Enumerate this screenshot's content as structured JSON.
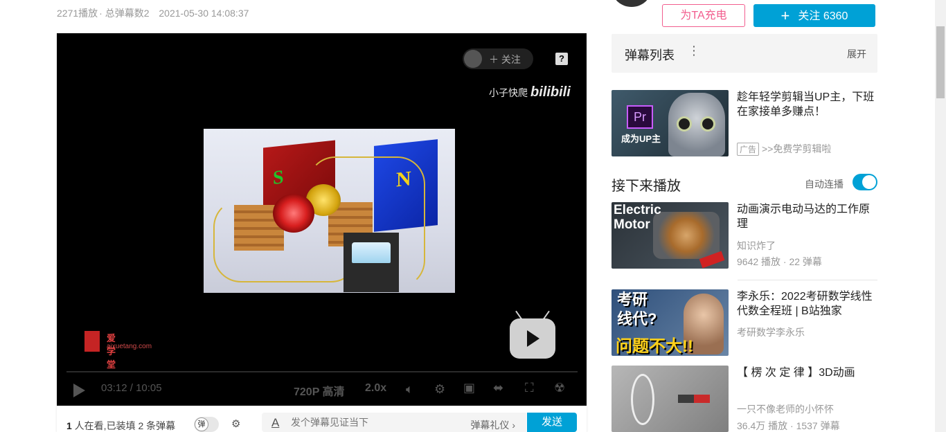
{
  "meta": {
    "plays": "2271播放",
    "danmaku": "· 总弹幕数2",
    "date": "2021-05-30 14:08:37"
  },
  "player": {
    "follow_label": "关注",
    "help": "?",
    "watermark_user": "小子快爬",
    "watermark_brand": "bilibili",
    "logo_text": "爱学堂",
    "logo_url": "aixuetang.com",
    "scene_s": "S",
    "scene_n": "N",
    "time_current": "03:12",
    "time_sep": "/",
    "time_total": "10:05",
    "quality": "720P 高清",
    "speed": "2.0x"
  },
  "danmaku_bar": {
    "watching_count": "1",
    "watching_text": " 人在看,已装填 2 条弹幕",
    "toggle_label": "弹",
    "input_placeholder": "发个弹幕见证当下",
    "etiquette": "弹幕礼仪 ›",
    "send": "发送"
  },
  "uploader": {
    "charge": "为TA充电",
    "follow": "关注 6360"
  },
  "danmaku_list": {
    "title": "弹幕列表",
    "expand": "展开"
  },
  "ad": {
    "title": "趁年轻学剪辑当UP主，下班在家接单多赚点！",
    "tag": "广告",
    "link": ">>免费学剪辑啦",
    "thumb_caption": "成为UP主",
    "thumb_app": "Pr"
  },
  "next": {
    "title": "接下来播放",
    "autoplay": "自动连播"
  },
  "recommendations": [
    {
      "title": "动画演示电动马达的工作原理",
      "author": "知识炸了",
      "stats": "9642 播放 · 22 弹幕",
      "thumb_text": "Electric Motor"
    },
    {
      "title": "李永乐：2022考研数学线性代数全程班 | B站独家",
      "author": "考研数学李永乐",
      "stats": "",
      "thumb_line1": "考研",
      "thumb_line2": "线代?",
      "thumb_big": "问题不大!!"
    },
    {
      "title": "【 楞 次 定 律 】3D动画",
      "author": "一只不像老师的小怀怀",
      "stats": "36.4万 播放 · 1537 弹幕"
    }
  ],
  "colors": {
    "accent": "#00a1d6",
    "charge": "#f25d8e"
  }
}
